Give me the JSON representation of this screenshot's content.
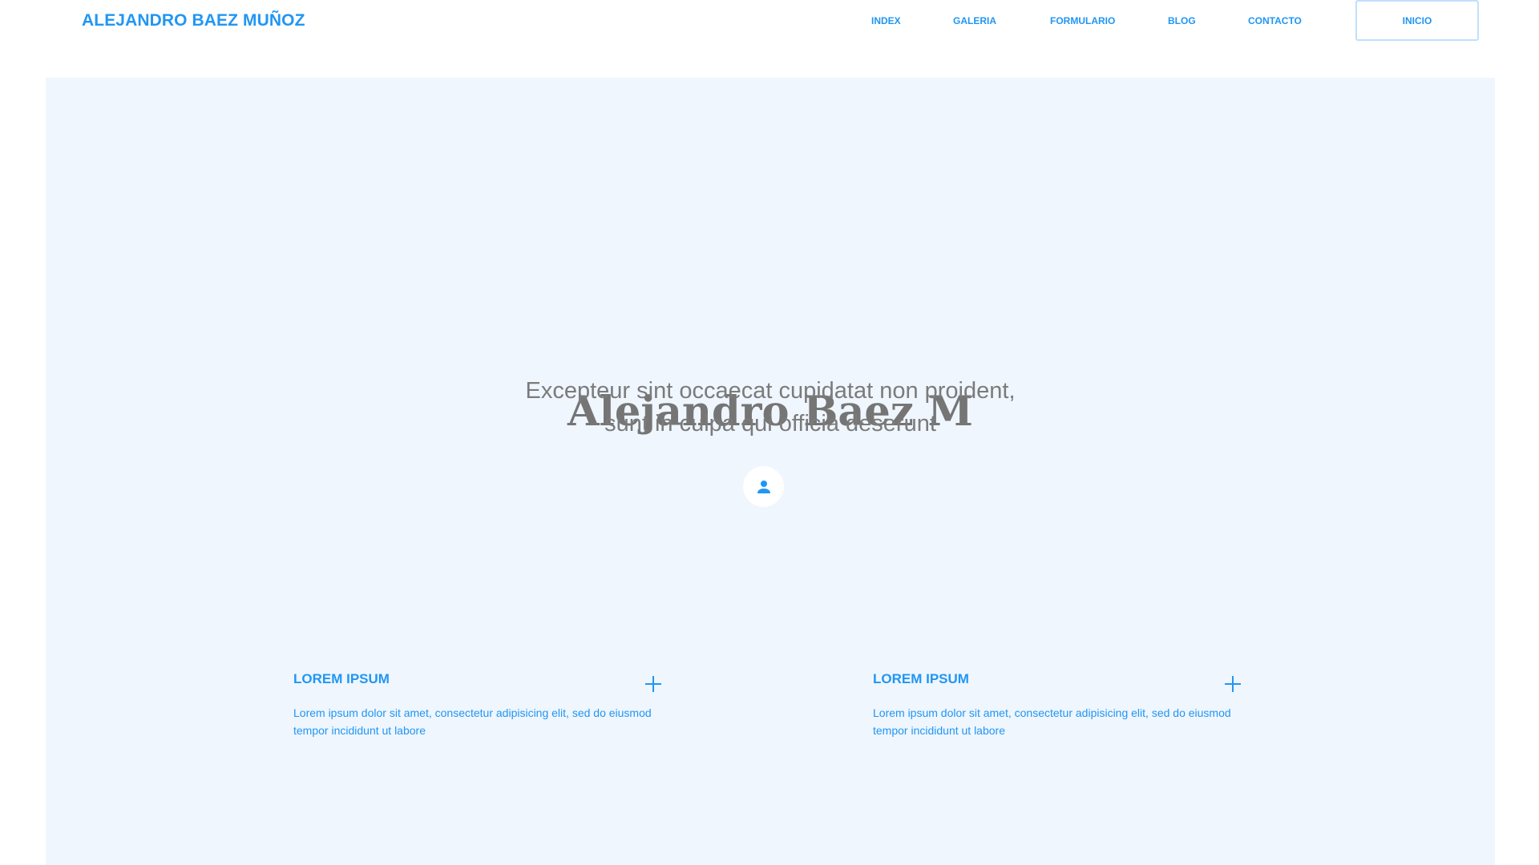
{
  "header": {
    "brand": "ALEJANDRO BAEZ MUÑOZ",
    "nav": [
      {
        "label": "INDEX"
      },
      {
        "label": "GALERIA"
      },
      {
        "label": "FORMULARIO"
      },
      {
        "label": "BLOG"
      },
      {
        "label": "CONTACTO"
      }
    ],
    "button_label": "INICIO"
  },
  "hero": {
    "title": "Alejandro Baez M",
    "subtitle_line1": "Excepteur sint occaecat cupidatat non proident,",
    "subtitle_line2": "sunt in culpa qui officia deserunt",
    "avatar_icon": "person-icon"
  },
  "cards": [
    {
      "title": "LOREM IPSUM",
      "text": "Lorem ipsum dolor sit amet, consectetur adipisicing elit, sed do eiusmod tempor incididunt ut labore",
      "icon": "plus-icon"
    },
    {
      "title": "LOREM IPSUM",
      "text": "Lorem ipsum dolor sit amet, consectetur adipisicing elit, sed do eiusmod tempor incididunt ut labore",
      "icon": "plus-icon"
    }
  ],
  "colors": {
    "accent": "#2196f3",
    "panel_bg": "#eff6fe",
    "heading_gray": "#757575"
  }
}
